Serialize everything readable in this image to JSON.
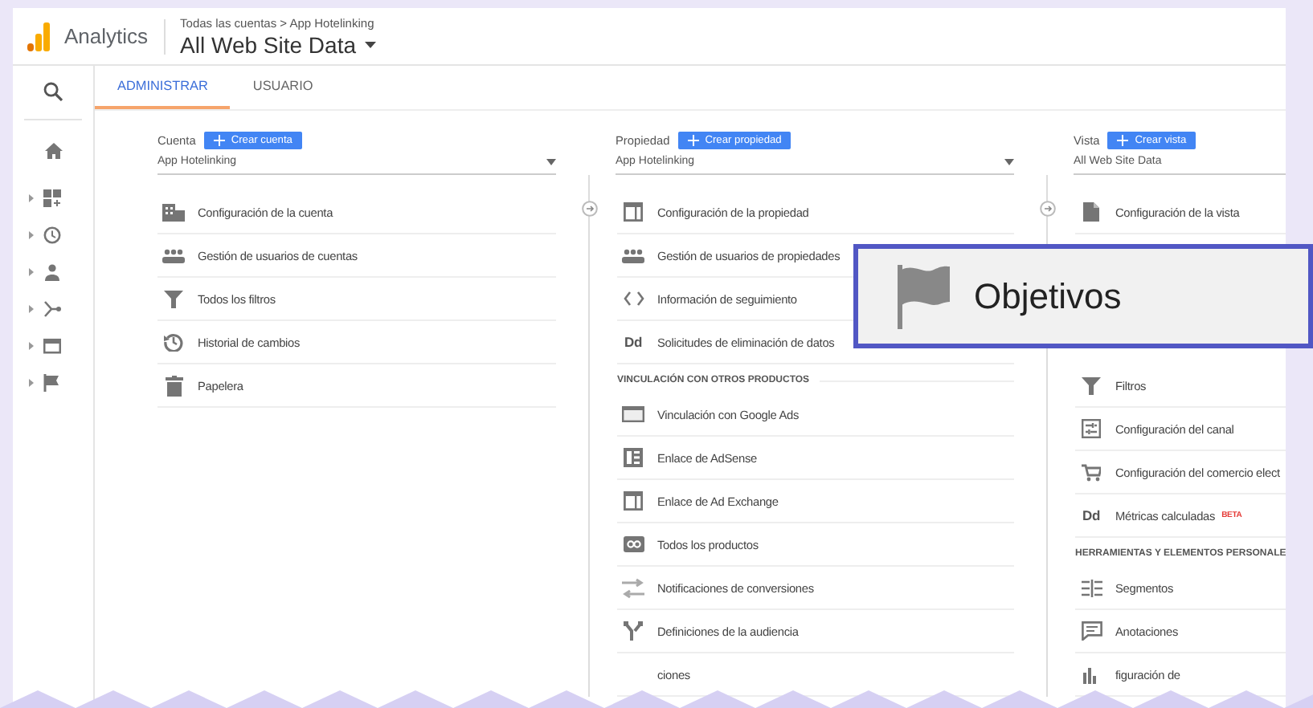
{
  "header": {
    "app_name": "Analytics",
    "breadcrumb": "Todas las cuentas > App Hotelinking",
    "view_name": "All Web Site Data"
  },
  "tabs": [
    {
      "label": "ADMINISTRAR",
      "selected": true
    },
    {
      "label": "USUARIO",
      "selected": false
    }
  ],
  "columns": [
    {
      "label": "Cuenta",
      "create_button": "Crear cuenta",
      "selector": "App Hotelinking",
      "items": [
        {
          "kind": "item",
          "label": "Configuración de la cuenta"
        },
        {
          "kind": "item",
          "label": "Gestión de usuarios de cuentas"
        },
        {
          "kind": "item",
          "label": "Todos los filtros"
        },
        {
          "kind": "item",
          "label": "Historial de cambios"
        },
        {
          "kind": "item",
          "label": "Papelera"
        }
      ]
    },
    {
      "label": "Propiedad",
      "create_button": "Crear propiedad",
      "selector": "App Hotelinking",
      "items": [
        {
          "kind": "item",
          "label": "Configuración de la propiedad"
        },
        {
          "kind": "item",
          "label": "Gestión de usuarios de propiedades"
        },
        {
          "kind": "item",
          "label": "Información de seguimiento"
        },
        {
          "kind": "item",
          "label": "Solicitudes de eliminación de datos",
          "icon_text": "Dd"
        },
        {
          "kind": "section",
          "label": "VINCULACIÓN CON OTROS PRODUCTOS"
        },
        {
          "kind": "item",
          "label": "Vinculación con Google Ads"
        },
        {
          "kind": "item",
          "label": "Enlace de AdSense"
        },
        {
          "kind": "item",
          "label": "Enlace de Ad Exchange"
        },
        {
          "kind": "item",
          "label": "Todos los productos"
        },
        {
          "kind": "item",
          "label": "Notificaciones de conversiones"
        },
        {
          "kind": "item",
          "label": "Definiciones de la audiencia"
        },
        {
          "kind": "item",
          "label": "ciones"
        }
      ]
    },
    {
      "label": "Vista",
      "create_button": "Crear vista",
      "selector": "All Web Site Data",
      "items": [
        {
          "kind": "item",
          "label": "Configuración de la vista"
        },
        {
          "kind": "item",
          "label": "Filtros"
        },
        {
          "kind": "item",
          "label": "Configuración del canal"
        },
        {
          "kind": "item",
          "label": "Configuración del comercio elect"
        },
        {
          "kind": "item",
          "label": "Métricas calculadas",
          "icon_text": "Dd",
          "badge": "BETA"
        },
        {
          "kind": "section",
          "label": "HERRAMIENTAS Y ELEMENTOS PERSONALE"
        },
        {
          "kind": "item",
          "label": "Segmentos"
        },
        {
          "kind": "item",
          "label": "Anotaciones"
        },
        {
          "kind": "item",
          "label": "figuración de"
        }
      ]
    }
  ],
  "callout": {
    "label": "Objetivos"
  }
}
